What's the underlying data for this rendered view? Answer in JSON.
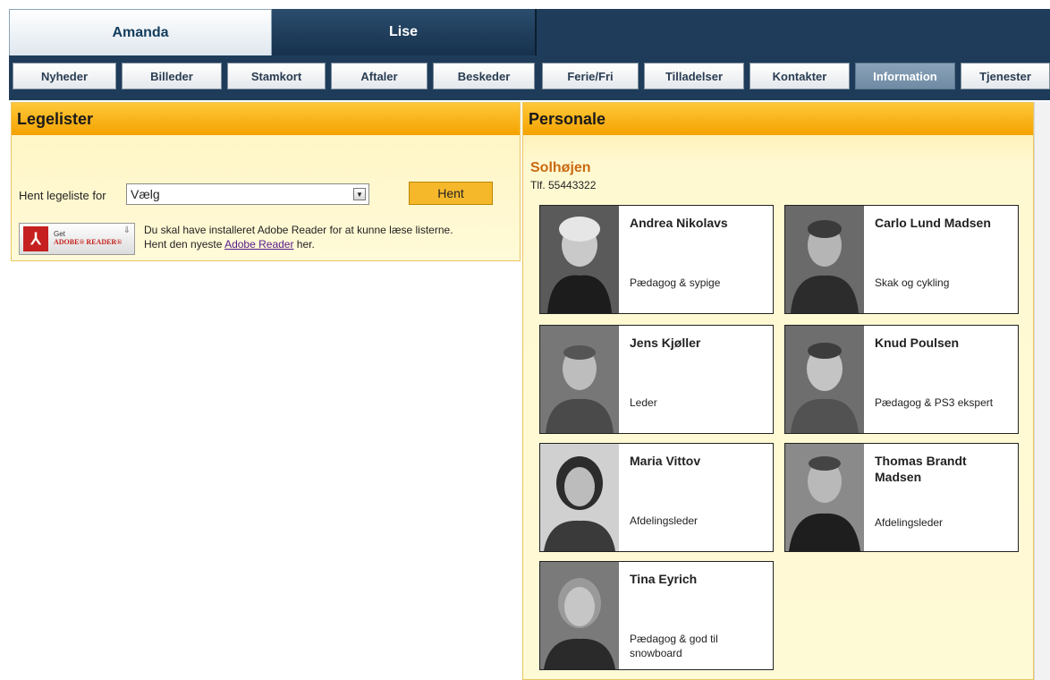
{
  "child_tabs": [
    {
      "label": "Amanda",
      "active": true
    },
    {
      "label": "Lise",
      "active": false
    }
  ],
  "nav": {
    "items": [
      "Nyheder",
      "Billeder",
      "Stamkort",
      "Aftaler",
      "Beskeder",
      "Ferie/Fri",
      "Tilladelser",
      "Kontakter",
      "Information",
      "Tjenester"
    ],
    "active": "Information"
  },
  "legelister": {
    "title": "Legelister",
    "fetch_label": "Hent legeliste for",
    "select_value": "Vælg",
    "button_label": "Hent",
    "adobe_badge": {
      "get": "Get",
      "reader": "ADOBE® READER®"
    },
    "notice_line1": "Du skal have installeret Adobe Reader for at kunne læse listerne.",
    "notice_prefix": "Hent den nyeste ",
    "notice_link": "Adobe Reader",
    "notice_suffix": " her."
  },
  "personale": {
    "title": "Personale",
    "org_name": "Solhøjen",
    "phone": "Tlf. 55443322",
    "staff": [
      {
        "name": "Andrea Nikolavs",
        "role": "Pædagog & sypige"
      },
      {
        "name": "Carlo Lund Madsen",
        "role": "Skak og cykling"
      },
      {
        "name": "Jens Kjøller",
        "role": "Leder"
      },
      {
        "name": "Knud Poulsen",
        "role": "Pædagog & PS3 ekspert"
      },
      {
        "name": "Maria Vittov",
        "role": "Afdelingsleder"
      },
      {
        "name": "Thomas Brandt Madsen",
        "role": "Afdelingsleder"
      },
      {
        "name": "Tina Eyrich",
        "role": "Pædagog & god til snowboard"
      }
    ]
  },
  "colors": {
    "nav_bg": "#1e3c59",
    "panel_header": "#f4a200",
    "panel_bg": "#fffad6",
    "org_name": "#c96a10"
  }
}
